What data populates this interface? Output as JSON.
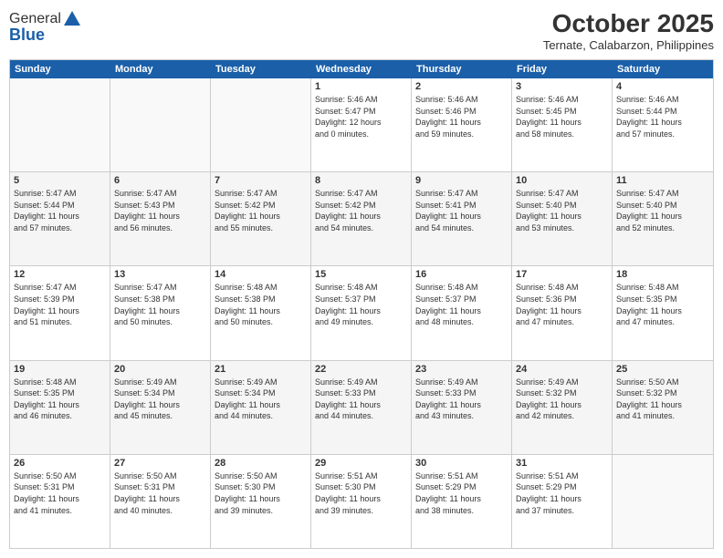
{
  "header": {
    "logo_general": "General",
    "logo_blue": "Blue",
    "month": "October 2025",
    "location": "Ternate, Calabarzon, Philippines"
  },
  "days_of_week": [
    "Sunday",
    "Monday",
    "Tuesday",
    "Wednesday",
    "Thursday",
    "Friday",
    "Saturday"
  ],
  "weeks": [
    {
      "cells": [
        {
          "day": "",
          "info": ""
        },
        {
          "day": "",
          "info": ""
        },
        {
          "day": "",
          "info": ""
        },
        {
          "day": "1",
          "info": "Sunrise: 5:46 AM\nSunset: 5:47 PM\nDaylight: 12 hours\nand 0 minutes."
        },
        {
          "day": "2",
          "info": "Sunrise: 5:46 AM\nSunset: 5:46 PM\nDaylight: 11 hours\nand 59 minutes."
        },
        {
          "day": "3",
          "info": "Sunrise: 5:46 AM\nSunset: 5:45 PM\nDaylight: 11 hours\nand 58 minutes."
        },
        {
          "day": "4",
          "info": "Sunrise: 5:46 AM\nSunset: 5:44 PM\nDaylight: 11 hours\nand 57 minutes."
        }
      ]
    },
    {
      "cells": [
        {
          "day": "5",
          "info": "Sunrise: 5:47 AM\nSunset: 5:44 PM\nDaylight: 11 hours\nand 57 minutes."
        },
        {
          "day": "6",
          "info": "Sunrise: 5:47 AM\nSunset: 5:43 PM\nDaylight: 11 hours\nand 56 minutes."
        },
        {
          "day": "7",
          "info": "Sunrise: 5:47 AM\nSunset: 5:42 PM\nDaylight: 11 hours\nand 55 minutes."
        },
        {
          "day": "8",
          "info": "Sunrise: 5:47 AM\nSunset: 5:42 PM\nDaylight: 11 hours\nand 54 minutes."
        },
        {
          "day": "9",
          "info": "Sunrise: 5:47 AM\nSunset: 5:41 PM\nDaylight: 11 hours\nand 54 minutes."
        },
        {
          "day": "10",
          "info": "Sunrise: 5:47 AM\nSunset: 5:40 PM\nDaylight: 11 hours\nand 53 minutes."
        },
        {
          "day": "11",
          "info": "Sunrise: 5:47 AM\nSunset: 5:40 PM\nDaylight: 11 hours\nand 52 minutes."
        }
      ]
    },
    {
      "cells": [
        {
          "day": "12",
          "info": "Sunrise: 5:47 AM\nSunset: 5:39 PM\nDaylight: 11 hours\nand 51 minutes."
        },
        {
          "day": "13",
          "info": "Sunrise: 5:47 AM\nSunset: 5:38 PM\nDaylight: 11 hours\nand 50 minutes."
        },
        {
          "day": "14",
          "info": "Sunrise: 5:48 AM\nSunset: 5:38 PM\nDaylight: 11 hours\nand 50 minutes."
        },
        {
          "day": "15",
          "info": "Sunrise: 5:48 AM\nSunset: 5:37 PM\nDaylight: 11 hours\nand 49 minutes."
        },
        {
          "day": "16",
          "info": "Sunrise: 5:48 AM\nSunset: 5:37 PM\nDaylight: 11 hours\nand 48 minutes."
        },
        {
          "day": "17",
          "info": "Sunrise: 5:48 AM\nSunset: 5:36 PM\nDaylight: 11 hours\nand 47 minutes."
        },
        {
          "day": "18",
          "info": "Sunrise: 5:48 AM\nSunset: 5:35 PM\nDaylight: 11 hours\nand 47 minutes."
        }
      ]
    },
    {
      "cells": [
        {
          "day": "19",
          "info": "Sunrise: 5:48 AM\nSunset: 5:35 PM\nDaylight: 11 hours\nand 46 minutes."
        },
        {
          "day": "20",
          "info": "Sunrise: 5:49 AM\nSunset: 5:34 PM\nDaylight: 11 hours\nand 45 minutes."
        },
        {
          "day": "21",
          "info": "Sunrise: 5:49 AM\nSunset: 5:34 PM\nDaylight: 11 hours\nand 44 minutes."
        },
        {
          "day": "22",
          "info": "Sunrise: 5:49 AM\nSunset: 5:33 PM\nDaylight: 11 hours\nand 44 minutes."
        },
        {
          "day": "23",
          "info": "Sunrise: 5:49 AM\nSunset: 5:33 PM\nDaylight: 11 hours\nand 43 minutes."
        },
        {
          "day": "24",
          "info": "Sunrise: 5:49 AM\nSunset: 5:32 PM\nDaylight: 11 hours\nand 42 minutes."
        },
        {
          "day": "25",
          "info": "Sunrise: 5:50 AM\nSunset: 5:32 PM\nDaylight: 11 hours\nand 41 minutes."
        }
      ]
    },
    {
      "cells": [
        {
          "day": "26",
          "info": "Sunrise: 5:50 AM\nSunset: 5:31 PM\nDaylight: 11 hours\nand 41 minutes."
        },
        {
          "day": "27",
          "info": "Sunrise: 5:50 AM\nSunset: 5:31 PM\nDaylight: 11 hours\nand 40 minutes."
        },
        {
          "day": "28",
          "info": "Sunrise: 5:50 AM\nSunset: 5:30 PM\nDaylight: 11 hours\nand 39 minutes."
        },
        {
          "day": "29",
          "info": "Sunrise: 5:51 AM\nSunset: 5:30 PM\nDaylight: 11 hours\nand 39 minutes."
        },
        {
          "day": "30",
          "info": "Sunrise: 5:51 AM\nSunset: 5:29 PM\nDaylight: 11 hours\nand 38 minutes."
        },
        {
          "day": "31",
          "info": "Sunrise: 5:51 AM\nSunset: 5:29 PM\nDaylight: 11 hours\nand 37 minutes."
        },
        {
          "day": "",
          "info": ""
        }
      ]
    }
  ]
}
